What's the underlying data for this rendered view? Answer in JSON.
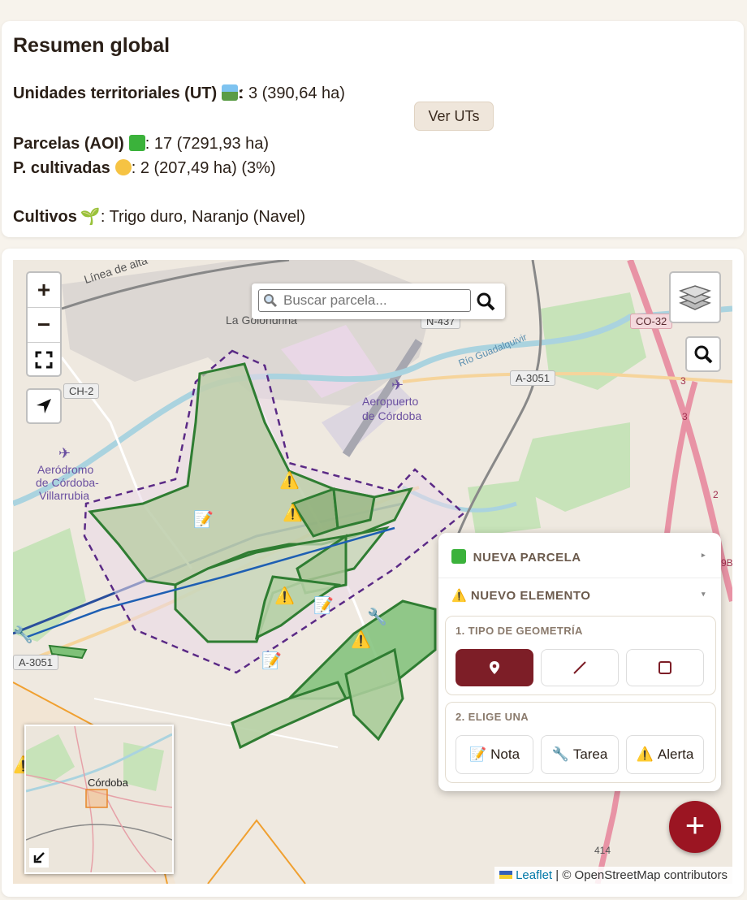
{
  "summary": {
    "title": "Resumen global",
    "ut_label": "Unidades territoriales (UT)",
    "ut_value": ": 3 (390,64 ha)",
    "ut_button": "Ver UTs",
    "aoi_label": "Parcelas (AOI)",
    "aoi_value": ": 17 (7291,93 ha)",
    "cult_parcels_label": "P. cultivadas",
    "cult_parcels_value": ": 2 (207,49 ha) (3%)",
    "crops_label": "Cultivos",
    "crops_value": ": Trigo duro, Naranjo (Navel)"
  },
  "map": {
    "search_placeholder": "Buscar parcela...",
    "zoom_in": "+",
    "zoom_out": "−",
    "labels": {
      "golondrina": "La Golondrina",
      "linea": "Línea de alta",
      "aeropuerto_1": "Aeropuerto",
      "aeropuerto_2": "de Córdoba",
      "aerodromo_1": "Aeródromo",
      "aerodromo_2": "de Córdoba-",
      "aerodromo_3": "Villarrubia",
      "rio": "Río Guadalquivir",
      "minimap_city": "Córdoba"
    },
    "road_shields": {
      "n437": "N-437",
      "co32": "CO-32",
      "ch2": "CH-2",
      "a3051_e": "A-3051",
      "a3051_w": "A-3051",
      "r414": "414",
      "r3a": "3",
      "r3b": "3",
      "r2": "2",
      "r9b": "9B"
    },
    "attribution": {
      "leaflet": "Leaflet",
      "rest": " | © OpenStreetMap contributors"
    }
  },
  "panel": {
    "new_parcel": "NUEVA PARCELA",
    "new_element": "NUEVO ELEMENTO",
    "step1": "1. TIPO DE GEOMETRÍA",
    "step2": "2. ELIGE UNA",
    "note": "Nota",
    "task": "Tarea",
    "alert": "Alerta"
  },
  "colors": {
    "accent": "#7d1e27",
    "fab": "#9b1522",
    "parcel_green": "#2f7d32",
    "ut_boundary": "#5b2a86"
  }
}
